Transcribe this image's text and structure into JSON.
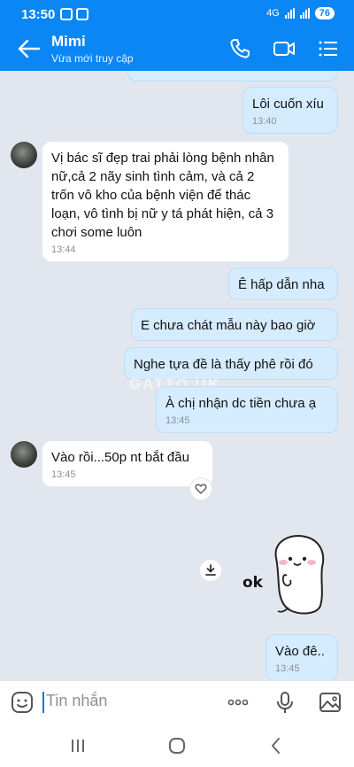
{
  "status_bar": {
    "time": "13:50",
    "network": "4G",
    "battery": "76"
  },
  "header": {
    "contact_name": "Mimi",
    "contact_status": "Vừa mới truy cập"
  },
  "messages": [
    {
      "text": "Lôi cuốn xíu",
      "time": "13:40"
    },
    {
      "text": "Vị bác sĩ đẹp trai phải lòng bệnh nhân nữ,cả 2 nãy sinh tình cảm, và cả 2 trốn vô kho của bệnh viện để thác loạn, vô tình bị nữ y tá phát hiện, cả 3 chơi some luôn",
      "time": "13:44"
    },
    {
      "text": "Ê hấp dẫn nha"
    },
    {
      "text": "E chưa chát mẫu này bao giờ"
    },
    {
      "text": "Nghe tựa đề là thấy phê rồi đó"
    },
    {
      "text": "À chị nhận dc tiền chưa ạ",
      "time": "13:45"
    },
    {
      "text": "Vào rồi...50p nt bắt đầu",
      "time": "13:45"
    },
    {
      "text": "Vào đê..",
      "time": "13:45"
    }
  ],
  "sticker_text": "ok",
  "watermark": "GATTO.UK",
  "input": {
    "placeholder": "Tin nhắn"
  },
  "colors": {
    "header": "#0a86f5",
    "outgoing_bubble": "#d5ecff",
    "incoming_bubble": "#ffffff",
    "chat_bg": "#e2e7ef"
  },
  "icons": [
    "back-arrow-icon",
    "phone-icon",
    "video-call-icon",
    "menu-list-icon",
    "sticker-emoji-icon",
    "more-dots-icon",
    "microphone-icon",
    "image-icon",
    "download-icon",
    "heart-icon"
  ]
}
